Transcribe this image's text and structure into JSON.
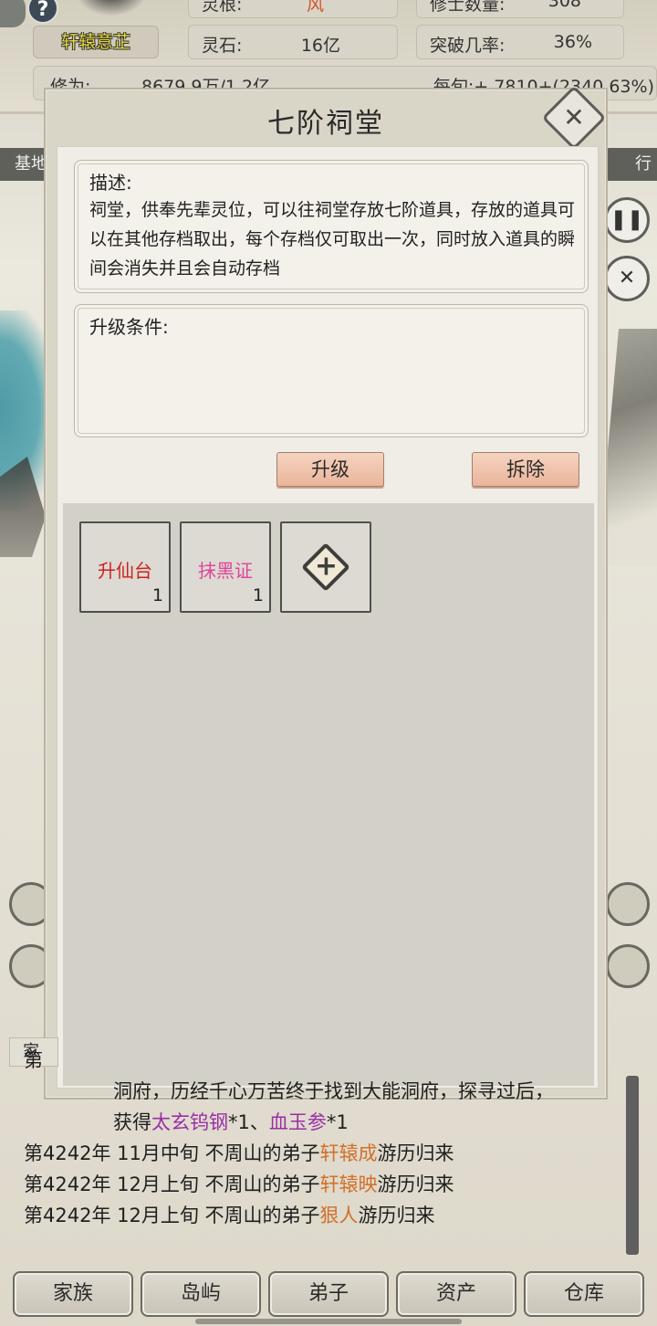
{
  "top_stats": {
    "name": "轩辕意芷",
    "spirit_root_label": "灵根:",
    "spirit_root_value": "风",
    "cultivators_label": "修士数量:",
    "cultivators_value": "308",
    "spirit_stone_label": "灵石:",
    "spirit_stone_value": "16亿",
    "breakthrough_label": "突破几率:",
    "breakthrough_value": "36%",
    "cultivation_label": "修为:",
    "cultivation_value": "8679.9万/1.2亿",
    "per_tick_value": "每旬:+ 7810+(2340.63%)",
    "help_icon": "?"
  },
  "side": {
    "left_tab": "基地",
    "right_tab": "行"
  },
  "modal": {
    "title": "七阶祠堂",
    "close_icon": "close-icon",
    "description_label": "描述:",
    "description_text": "祠堂，供奉先辈灵位，可以往祠堂存放七阶道具，存放的道具可以在其他存档取出，每个存档仅可取出一次，同时放入道具的瞬间会消失并且会自动存档",
    "requirements_label": "升级条件:",
    "requirements_text": "",
    "upgrade_button": "升级",
    "remove_button": "拆除",
    "items": [
      {
        "name": "升仙台",
        "count": "1",
        "color": "#d11f1f"
      },
      {
        "name": "抹黑证",
        "count": "1",
        "color": "#e0449b"
      }
    ],
    "add_slot_icon": "plus-icon"
  },
  "log": {
    "tab_label": "家",
    "lines": [
      {
        "prefix": "第",
        "parts": []
      },
      {
        "text": "洞府，历经千心万苦终于找到大能洞府，探寻过后，"
      },
      {
        "text_a": "获得",
        "item1": "太玄钨钢",
        "mid": "*1、",
        "item2": "血玉参",
        "end": "*1"
      },
      {
        "date": "第4242年 11月中旬",
        "pre": " 不周山的弟子",
        "name": "轩辕成",
        "post": "游历归来"
      },
      {
        "date": "第4242年 12月上旬",
        "pre": " 不周山的弟子",
        "name": "轩辕映",
        "post": "游历归来"
      },
      {
        "date": "第4242年 12月上旬",
        "pre": " 不周山的弟子",
        "name": "狠人",
        "post": "游历归来"
      }
    ]
  },
  "nav": [
    "家族",
    "岛屿",
    "弟子",
    "资产",
    "仓库"
  ]
}
